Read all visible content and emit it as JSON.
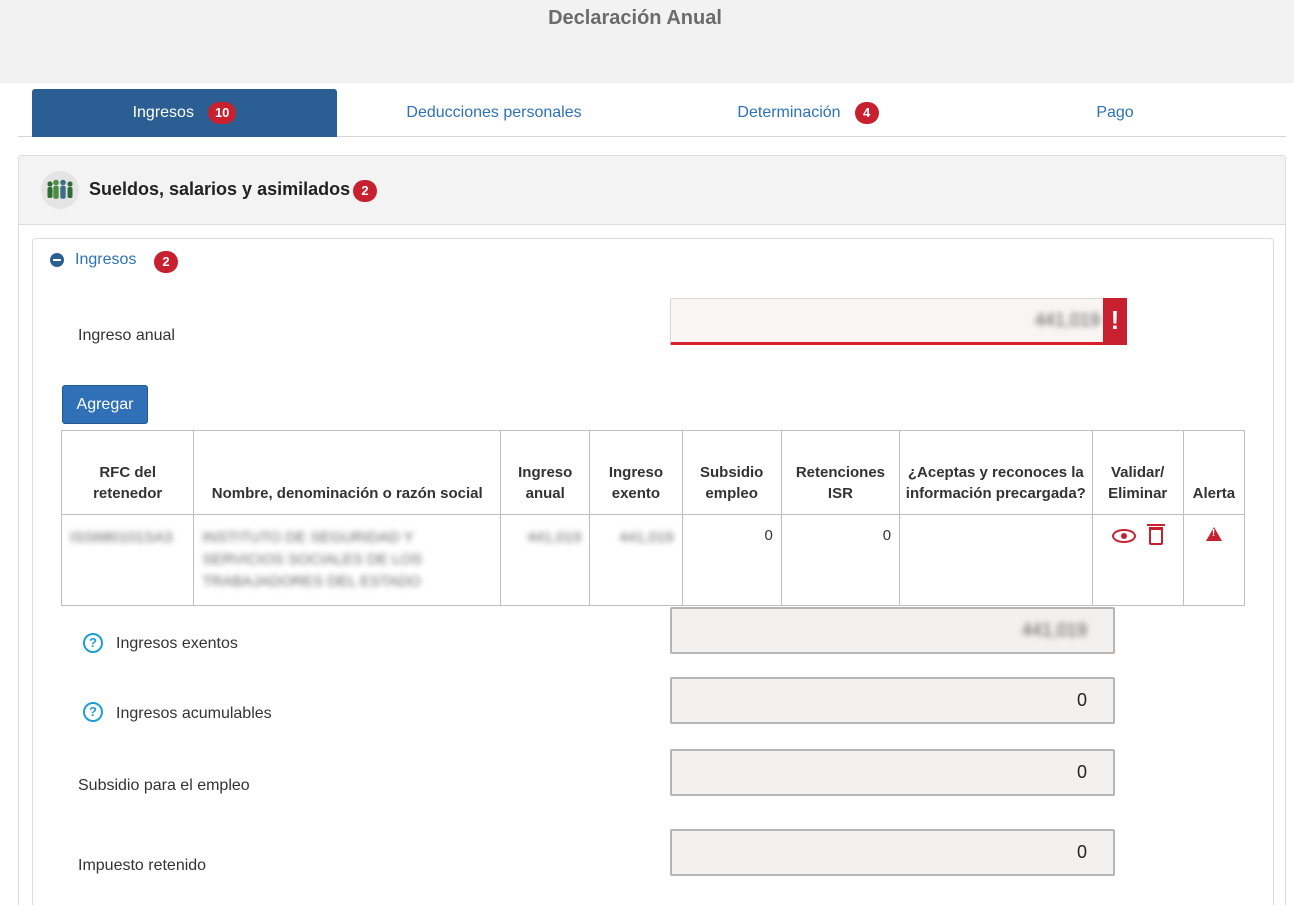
{
  "page": {
    "title": "Declaración Anual"
  },
  "tabs": [
    {
      "label": "Ingresos",
      "badge": "10"
    },
    {
      "label": "Deducciones personales",
      "badge": ""
    },
    {
      "label": "Determinación",
      "badge": "4"
    },
    {
      "label": "Pago",
      "badge": ""
    }
  ],
  "section": {
    "title": "Sueldos, salarios y asimilados",
    "badge": "2"
  },
  "panel": {
    "title": "Ingresos",
    "badge": "2"
  },
  "fields": {
    "ingreso_anual": {
      "label": "Ingreso anual",
      "value": "441,019",
      "error_mark": "!"
    },
    "ingresos_exentos": {
      "label": "Ingresos exentos",
      "value": "441,019"
    },
    "ingresos_acumulables": {
      "label": "Ingresos acumulables",
      "value": "0"
    },
    "subsidio_empleo": {
      "label": "Subsidio para el empleo",
      "value": "0"
    },
    "impuesto_retenido": {
      "label": "Impuesto retenido",
      "value": "0"
    }
  },
  "help_glyph": "?",
  "buttons": {
    "agregar": "Agregar"
  },
  "table": {
    "headers": {
      "rfc": "RFC del retenedor",
      "nombre": "Nombre, denominación o razón social",
      "ingreso_anual": "Ingreso anual",
      "ingreso_exento": "Ingreso exento",
      "subsidio": "Subsidio empleo",
      "retenciones": "Retenciones ISR",
      "acepta": "¿Aceptas y reconoces la información precargada?",
      "validar": "Validar/ Eliminar",
      "alerta": "Alerta"
    },
    "rows": [
      {
        "rfc": "ISS680101SA3",
        "nombre": "INSTITUTO DE SEGURIDAD Y SERVICIOS SOCIALES DE LOS TRABAJADORES DEL ESTADO",
        "ingreso_anual": "441,019",
        "ingreso_exento": "441,019",
        "subsidio": "0",
        "retenciones": "0",
        "acepta": ""
      }
    ]
  },
  "colors": {
    "primary": "#2b5f94",
    "link": "#2d72b8",
    "badge": "#c8202f",
    "error": "#d7222e",
    "help": "#1e9fd4"
  },
  "icons": {
    "people": "people-group-icon",
    "collapse": "minus-circle-icon",
    "help": "question-circle-icon",
    "view": "eye-icon",
    "delete": "trash-icon",
    "alert": "warning-triangle-icon"
  }
}
